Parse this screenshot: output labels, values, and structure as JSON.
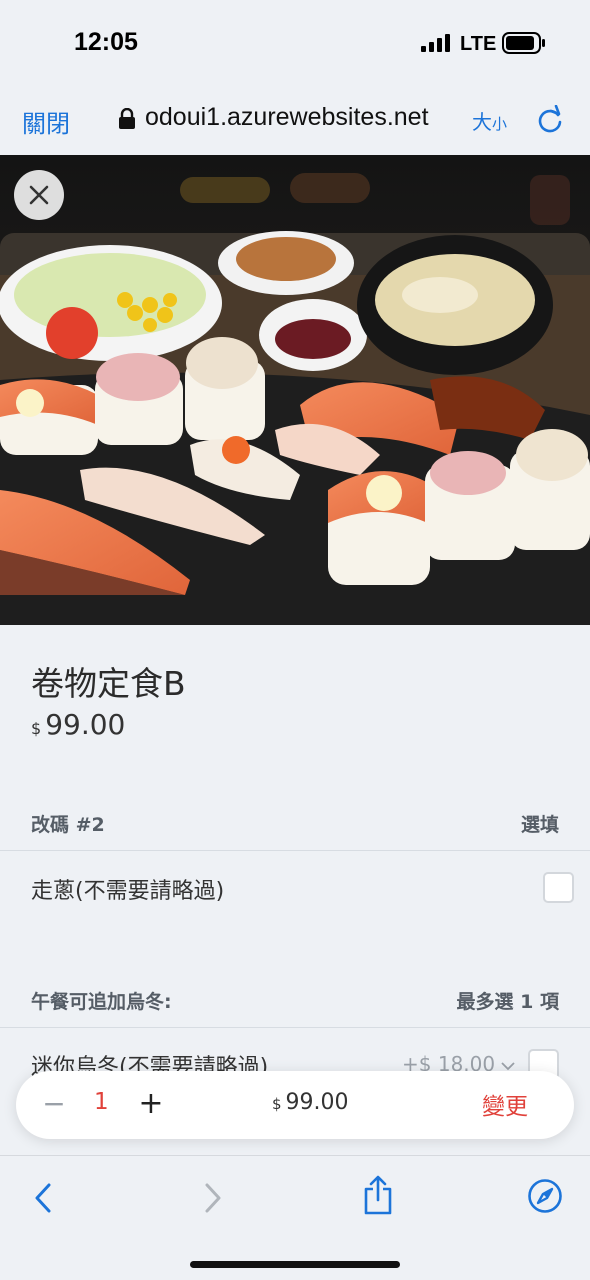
{
  "status_bar": {
    "time": "12:05",
    "network": "LTE"
  },
  "browser": {
    "close_label": "關閉",
    "url": "odoui1.azurewebsites.net",
    "text_size_big": "大",
    "text_size_small": "小"
  },
  "product": {
    "name": "卷物定食B",
    "currency": "$",
    "price": "99.00"
  },
  "option_groups": [
    {
      "title": "改碼 #2",
      "requirement": "選填",
      "options": [
        {
          "label": "走蔥(不需要請略過)",
          "price": "",
          "checked": false
        }
      ]
    },
    {
      "title": "午餐可追加烏冬:",
      "requirement": "最多選 1 項",
      "options": [
        {
          "label": "迷你烏冬(不需要請略過)",
          "price": "+$ 18.00",
          "checked": false
        }
      ]
    }
  ],
  "cart": {
    "minus": "−",
    "quantity": "1",
    "plus": "+",
    "currency": "$",
    "total": "99.00",
    "change_label": "變更"
  },
  "colors": {
    "ios_blue": "#1c74d9",
    "accent_red": "#e0413a",
    "background": "#eef1f5"
  },
  "icons": [
    "lock-icon",
    "reload-icon",
    "close-icon",
    "back-icon",
    "forward-icon",
    "share-icon",
    "compass-icon",
    "chevron-down-icon"
  ]
}
